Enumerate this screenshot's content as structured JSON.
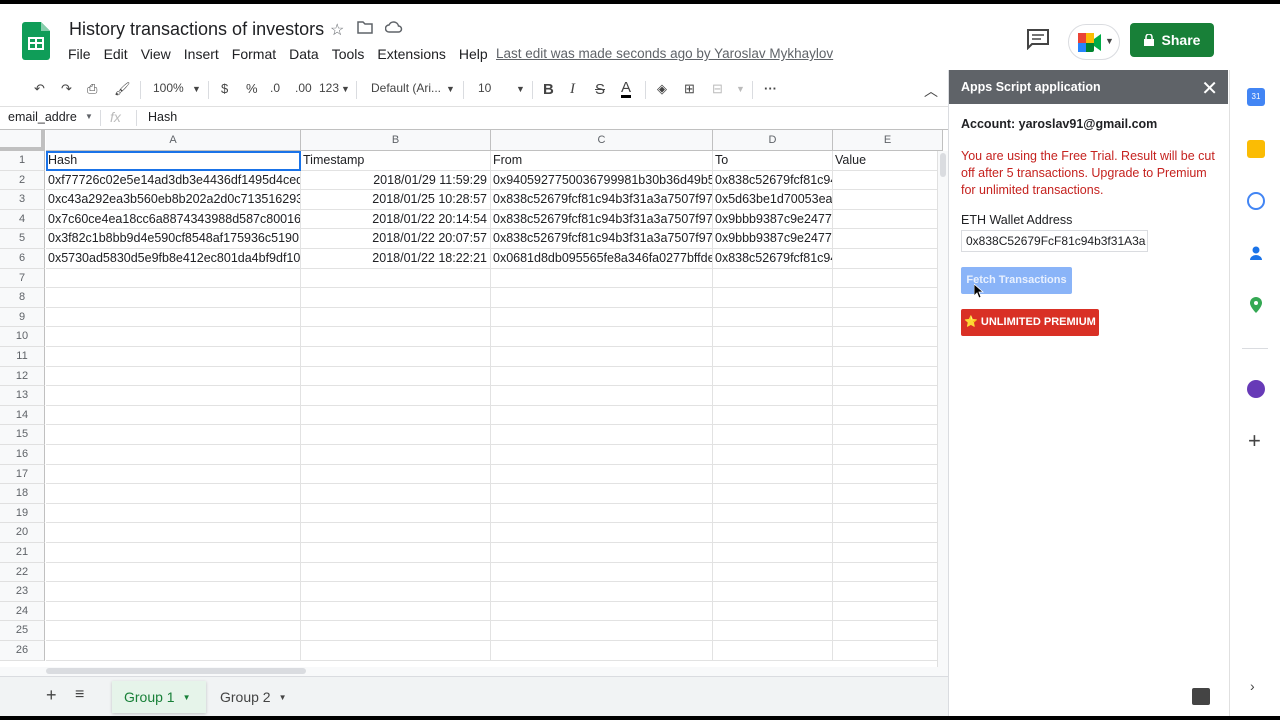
{
  "app": {
    "title": "History transactions of investors",
    "menu": [
      "File",
      "Edit",
      "View",
      "Insert",
      "Format",
      "Data",
      "Tools",
      "Extensions",
      "Help"
    ],
    "last_edit": "Last edit was made seconds ago by Yaroslav Mykhaylov",
    "share_label": "Share"
  },
  "toolbar": {
    "zoom": "100%",
    "currency": "$",
    "percent": "%",
    "dec_decrease": ".0",
    "dec_increase": ".00",
    "format_more": "123",
    "font": "Default (Ari...",
    "font_size": "10",
    "bold": "B",
    "italic": "I",
    "strike": "S",
    "text_color": "A"
  },
  "formula_bar": {
    "name_box": "email_addre",
    "fx": "fx",
    "value": "Hash"
  },
  "grid": {
    "columns": [
      "A",
      "B",
      "C",
      "D",
      "E"
    ],
    "rows": [
      "1",
      "2",
      "3",
      "4",
      "5",
      "6",
      "7",
      "8",
      "9",
      "10",
      "11",
      "12",
      "13",
      "14",
      "15",
      "16",
      "17",
      "18",
      "19",
      "20",
      "21",
      "22",
      "23",
      "24",
      "25",
      "26"
    ],
    "data": [
      [
        "Hash",
        "Timestamp",
        "From",
        "To",
        "Value"
      ],
      [
        "0xf77726c02e5e14ad3db3e4436df1495d4ced",
        "2018/01/29 11:59:29",
        "0x9405927750036799981b30b36d49b5",
        "0x838c52679fcf81c94",
        ""
      ],
      [
        "0xc43a292ea3b560eb8b202a2d0c713516293",
        "2018/01/25 10:28:57",
        "0x838c52679fcf81c94b3f31a3a7507f97",
        "0x5d63be1d70053ea",
        ""
      ],
      [
        "0x7c60ce4ea18cc6a8874343988d587c80016",
        "2018/01/22 20:14:54",
        "0x838c52679fcf81c94b3f31a3a7507f97",
        "0x9bbb9387c9e2477",
        ""
      ],
      [
        "0x3f82c1b8bb9d4e590cf8548af175936c5190",
        "2018/01/22 20:07:57",
        "0x838c52679fcf81c94b3f31a3a7507f97",
        "0x9bbb9387c9e2477",
        ""
      ],
      [
        "0x5730ad5830d5e9fb8e412ec801da4bf9df10",
        "2018/01/22 18:22:21",
        "0x0681d8db095565fe8a346fa0277bffde",
        "0x838c52679fcf81c94",
        ""
      ]
    ]
  },
  "tabs": [
    {
      "label": "Group 1",
      "active": true
    },
    {
      "label": "Group 2",
      "active": false
    }
  ],
  "sidebar": {
    "title": "Apps Script application",
    "account": "Account: yaroslav91@gmail.com",
    "warning": "You are using the Free Trial. Result will be cut off after 5 transactions. Upgrade to Premium for unlimited transactions.",
    "eth_label": "ETH Wallet Address",
    "eth_value": "0x838C52679FcF81c94b3f31A3a",
    "fetch_label": "Fetch Transactions",
    "premium_label": "⭐ UNLIMITED PREMIUM"
  },
  "colors": {
    "share_green": "#188038",
    "sidebar_header": "#5f6368",
    "warning_red": "#c5221f",
    "fetch_blue": "#8ab4f8",
    "premium_red": "#d93025"
  }
}
